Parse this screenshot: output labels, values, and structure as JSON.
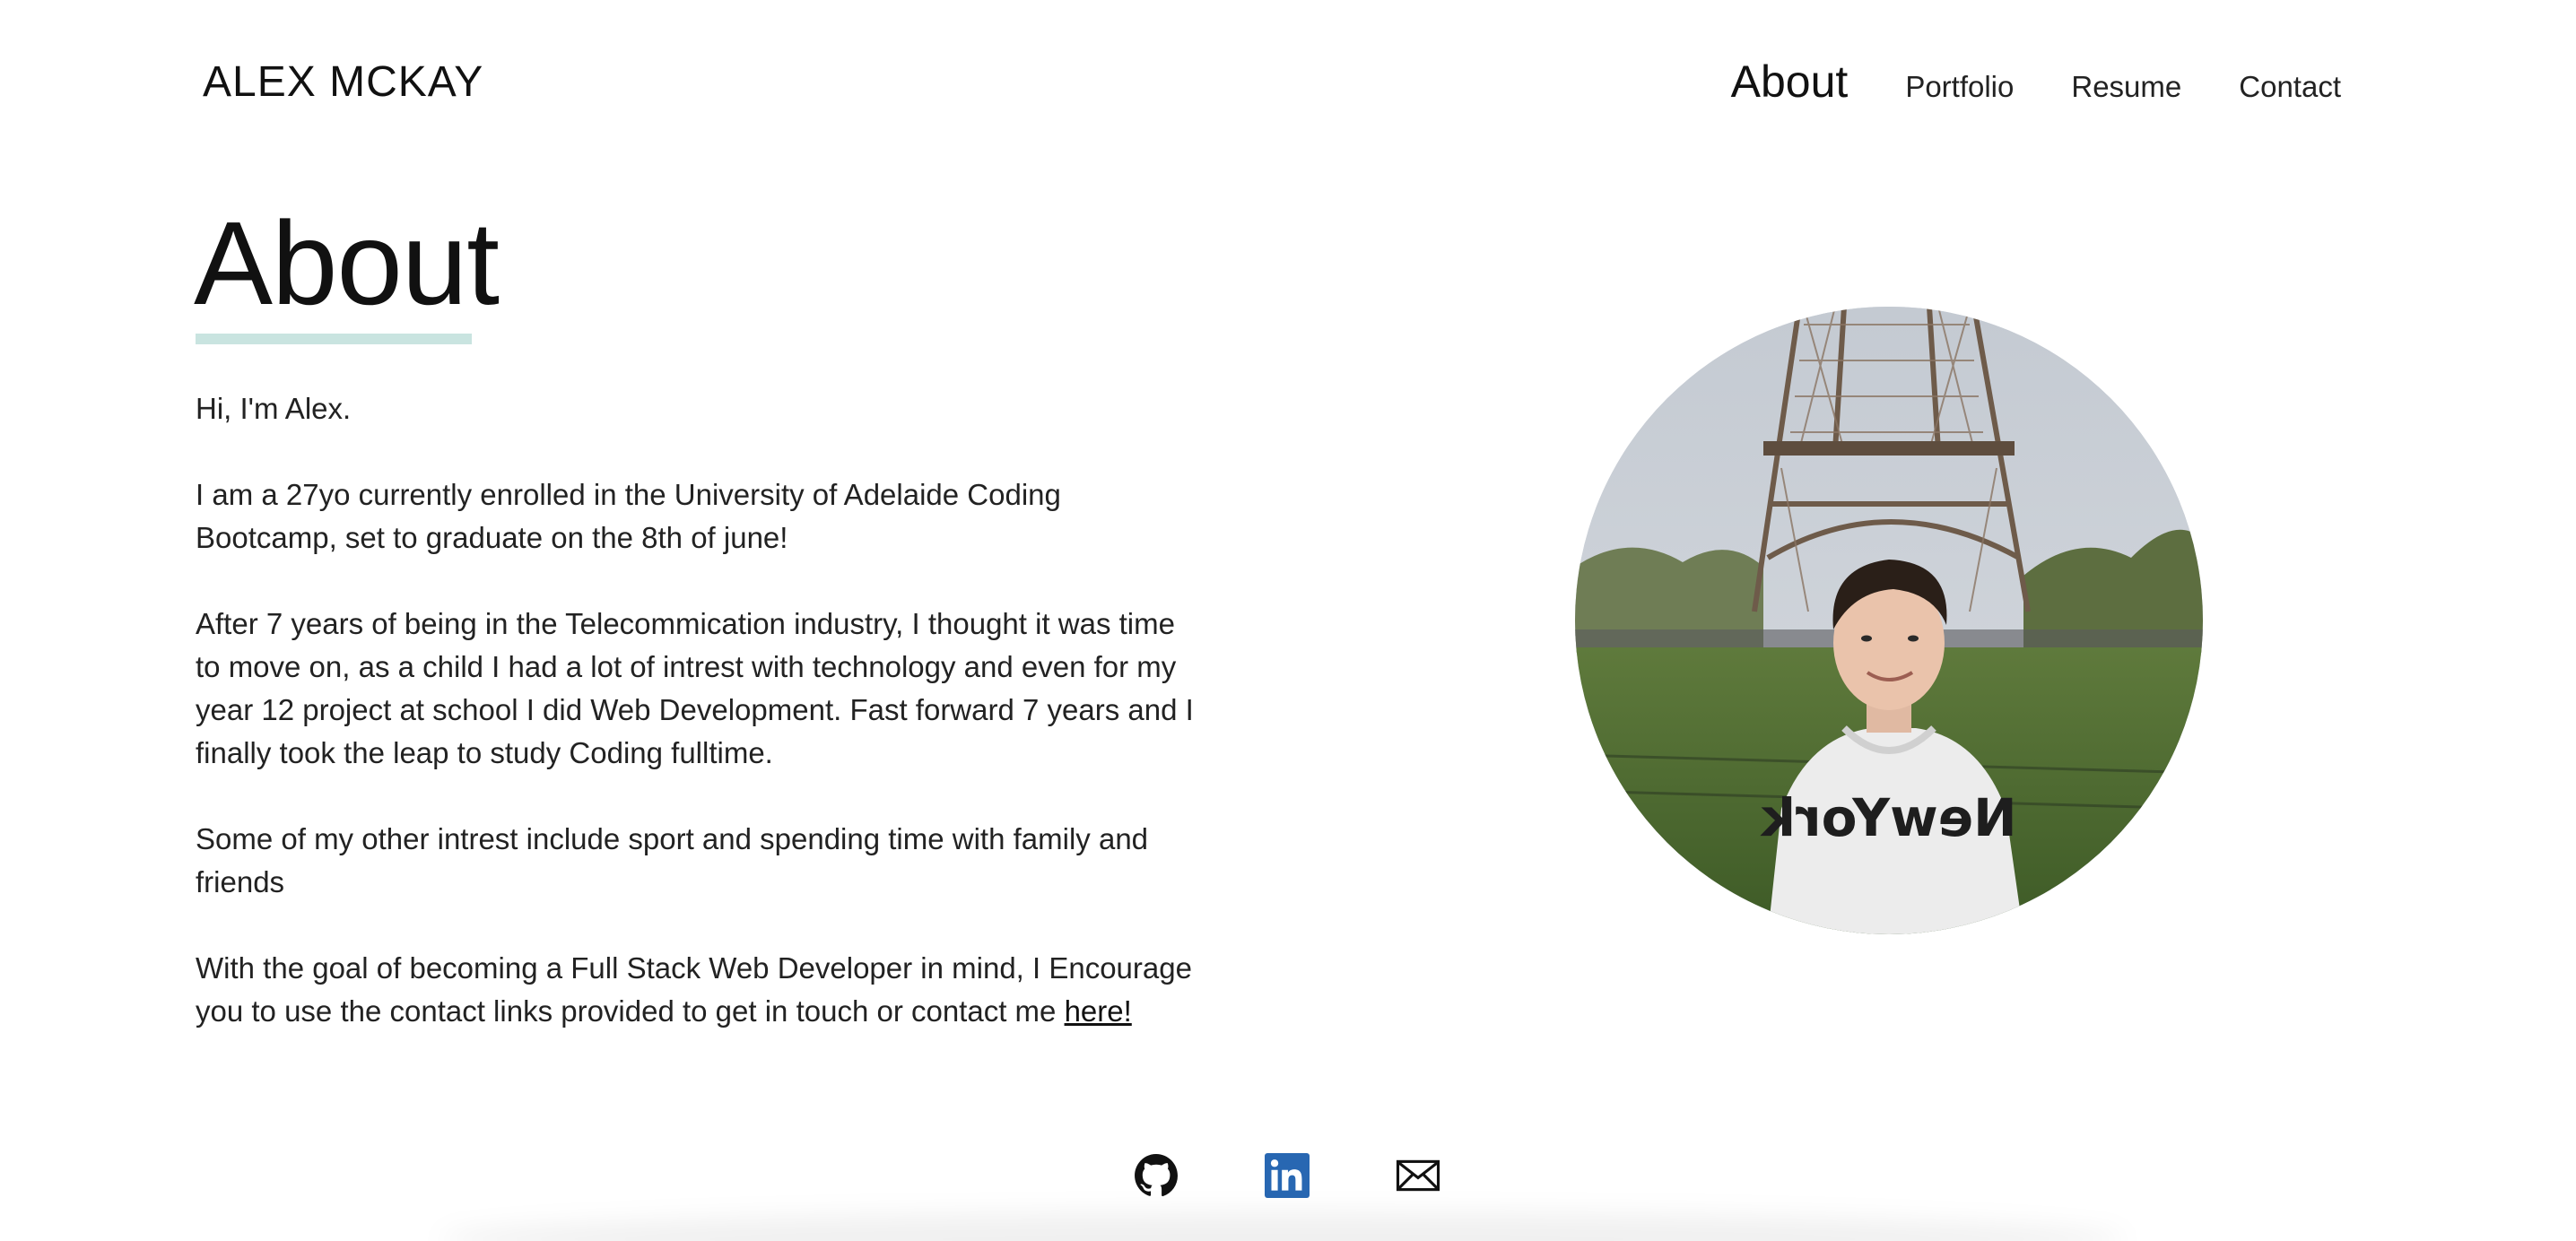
{
  "header": {
    "brand": "ALEX MCKAY",
    "nav": [
      {
        "label": "About",
        "active": true
      },
      {
        "label": "Portfolio",
        "active": false
      },
      {
        "label": "Resume",
        "active": false
      },
      {
        "label": "Contact",
        "active": false
      }
    ]
  },
  "main": {
    "title": "About",
    "paragraphs": [
      "Hi, I'm Alex.",
      "I am a 27yo currently enrolled in the University of Adelaide Coding Bootcamp, set to graduate on the 8th of june!",
      "After 7 years of being in the Telecommication industry, I thought it was time to move on, as a child I had a lot of intrest with technology and even for my year 12 project at school I did Web Development. Fast forward 7 years and I finally took the leap to study Coding fulltime.",
      "Some of my other intrest include sport and spending time with family and friends"
    ],
    "closing_text": "With the goal of becoming a Full Stack Web Developer in mind, I Encourage you to use the contact links provided to get in touch or contact me ",
    "closing_link": "here!"
  },
  "socials": [
    {
      "icon": "github-icon"
    },
    {
      "icon": "linkedin-icon"
    },
    {
      "icon": "mail-icon"
    }
  ],
  "colors": {
    "accent_underline": "#c9e4e0",
    "linkedin_blue": "#2867b2"
  }
}
